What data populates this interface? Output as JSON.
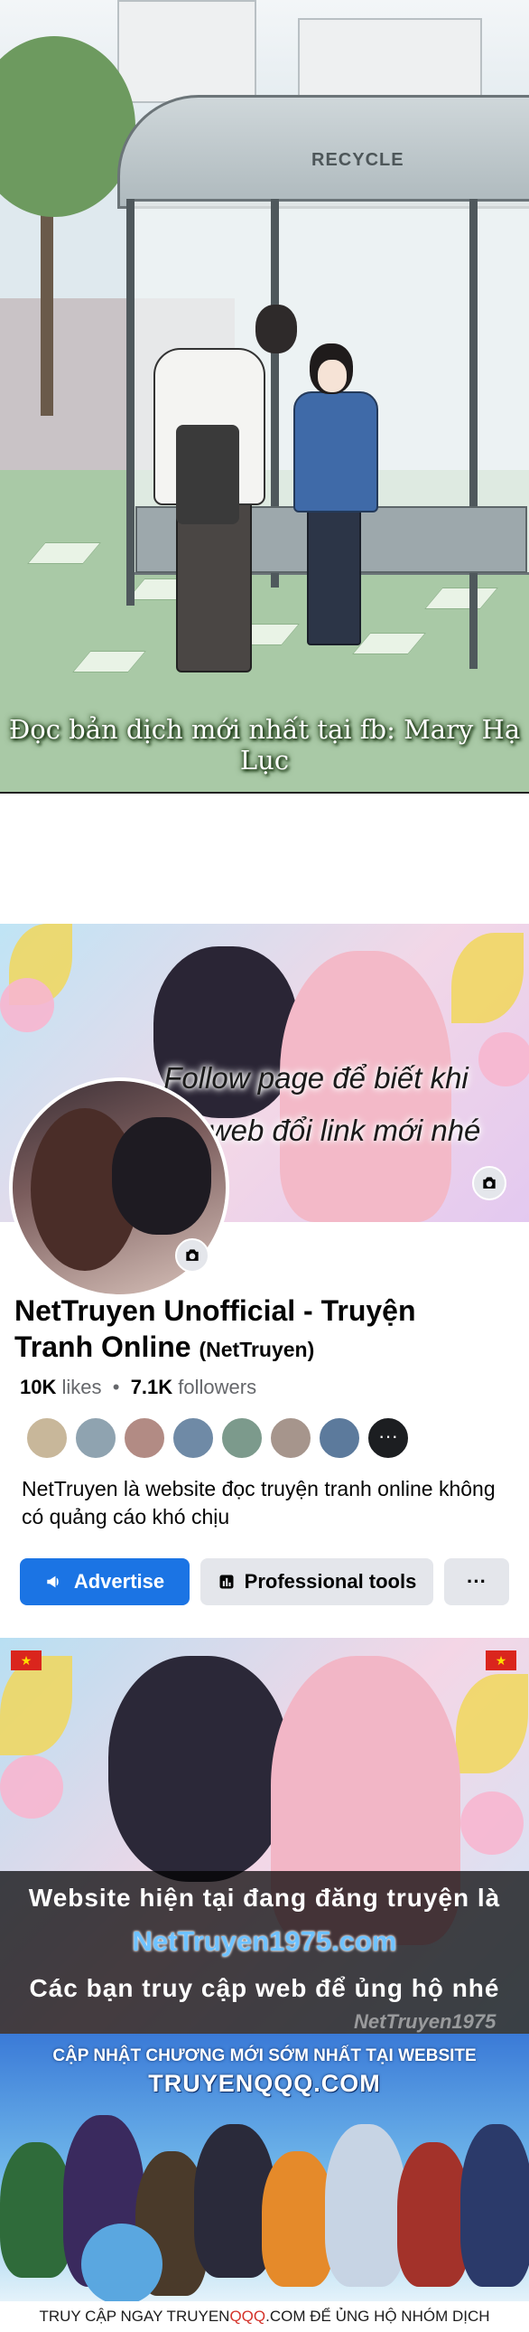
{
  "panel1": {
    "sign": "RECYCLE",
    "caption": "Đọc bản dịch mới nhất tại fb: Mary Hạ Lục"
  },
  "fb_page": {
    "cover_text_line1": "Follow page để biết khi",
    "cover_text_line2": "nào web đổi link mới nhé",
    "name": "NetTruyen Unofficial - Truyện Tranh Online",
    "handle": "(NetTruyen)",
    "likes_count": "10K",
    "likes_label": "likes",
    "followers_count": "7.1K",
    "followers_label": "followers",
    "more_friends": "···",
    "description": "NetTruyen là website đọc truyện tranh online không có quảng cáo khó chịu",
    "buttons": {
      "advertise": "Advertise",
      "professional_tools": "Professional tools",
      "more": "···"
    },
    "colors": {
      "primary": "#1b74e4",
      "secondary_bg": "#e4e6eb"
    }
  },
  "nettruyen_banner": {
    "line1": "Website hiện tại đang đăng truyện là",
    "url": "NetTruyen1975.com",
    "line2": "Các bạn truy cập web để ủng hộ nhé",
    "watermark": "NetTruyen1975",
    "flag_star": "★"
  },
  "qqq_banner": {
    "line1": "CẬP NHẬT CHƯƠNG MỚI SỚM NHẤT TẠI WEBSITE",
    "site": "TRUYENQQQ.COM",
    "footer_prefix": "TRUY CẬP NGAY TRUYEN",
    "footer_highlight": "QQQ",
    "footer_suffix": ".COM ĐỂ ỦNG HỘ NHÓM DỊCH"
  },
  "icons": {
    "camera": "camera-icon",
    "megaphone": "megaphone-icon",
    "chart": "chart-icon",
    "more": "more-icon"
  }
}
